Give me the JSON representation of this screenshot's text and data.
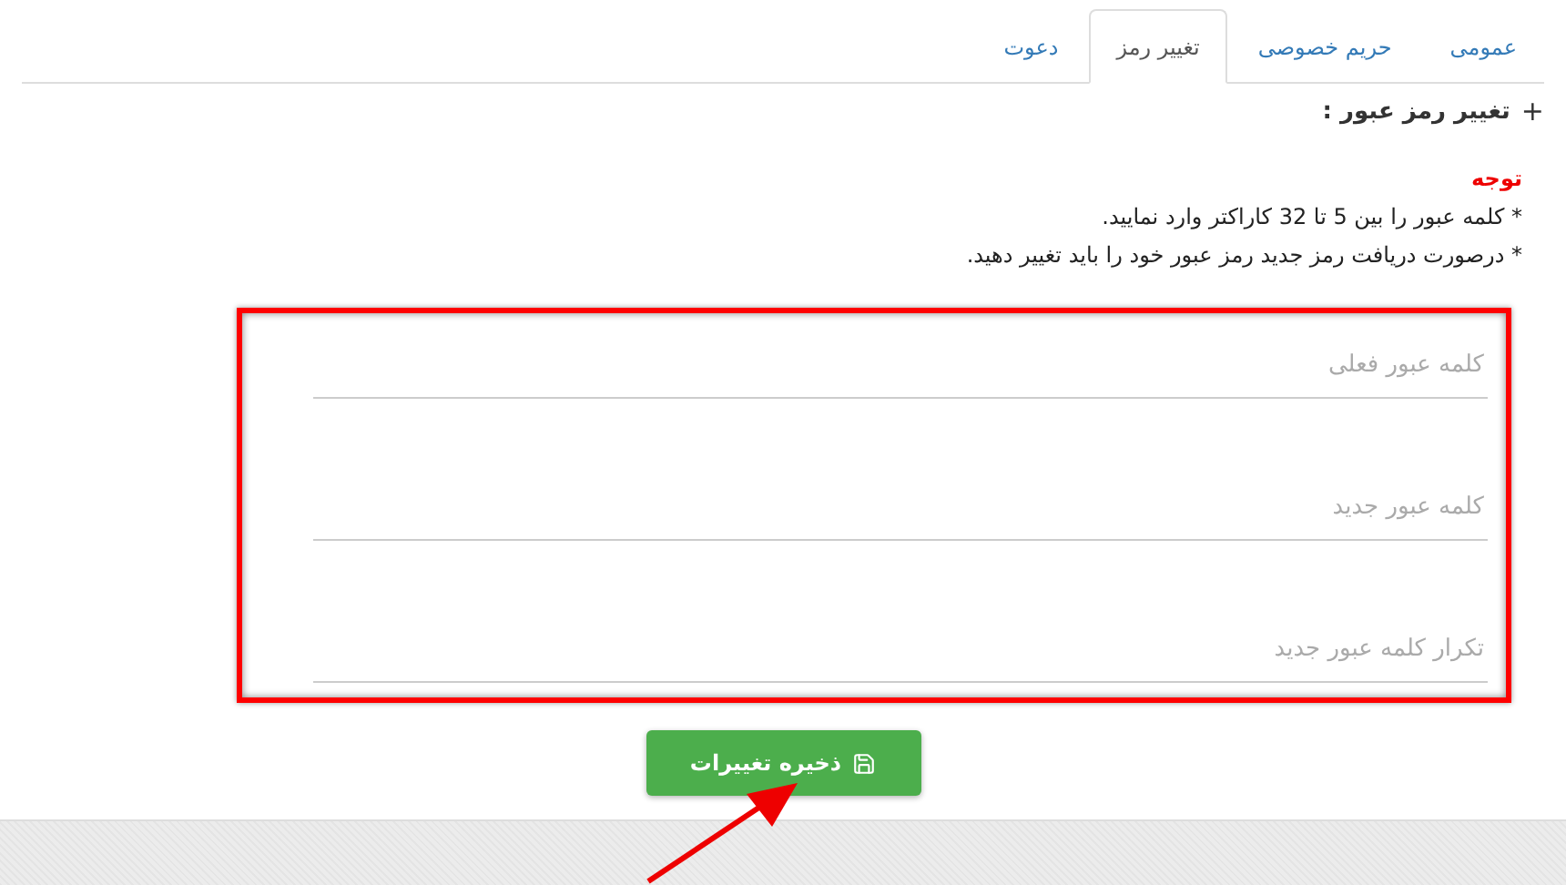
{
  "tabs": [
    {
      "label": "عمومی",
      "selected": false
    },
    {
      "label": "حریم خصوصی",
      "selected": false
    },
    {
      "label": "تغییر رمز",
      "selected": true
    },
    {
      "label": "دعوت",
      "selected": false
    }
  ],
  "section_title": {
    "toggle": "+",
    "text": "تغییر رمز عبور :"
  },
  "notice": {
    "title": "توجه",
    "lines": [
      "* کلمه عبور را بین 5 تا 32 کاراکتر وارد نمایید.",
      "* درصورت دریافت رمز جدید رمز عبور خود را باید تغییر دهید."
    ]
  },
  "fields": [
    {
      "placeholder": "کلمه عبور فعلی"
    },
    {
      "placeholder": "کلمه عبور جدید"
    },
    {
      "placeholder": "تکرار کلمه عبور جدید"
    }
  ],
  "save_button": {
    "label": "ذخیره تغییرات"
  }
}
